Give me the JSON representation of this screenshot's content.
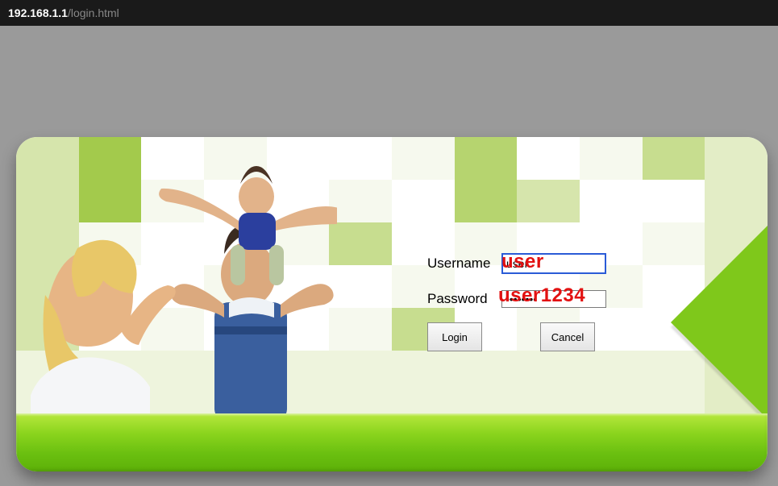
{
  "url": {
    "host": "192.168.1.1",
    "path": "/login.html"
  },
  "form": {
    "username_label": "Username",
    "password_label": "Password",
    "username_value": "user",
    "password_value": "user1234",
    "login_button": "Login",
    "cancel_button": "Cancel"
  },
  "tiles": {
    "rows": 7,
    "cols": 12,
    "shades": [
      "#ffffff",
      "#f6f9ee",
      "#eef4dd",
      "#e3edc6",
      "#d6e5ac",
      "#c7dd8f",
      "#b6d46f",
      "#a3ca4c",
      "#8abf22"
    ]
  }
}
